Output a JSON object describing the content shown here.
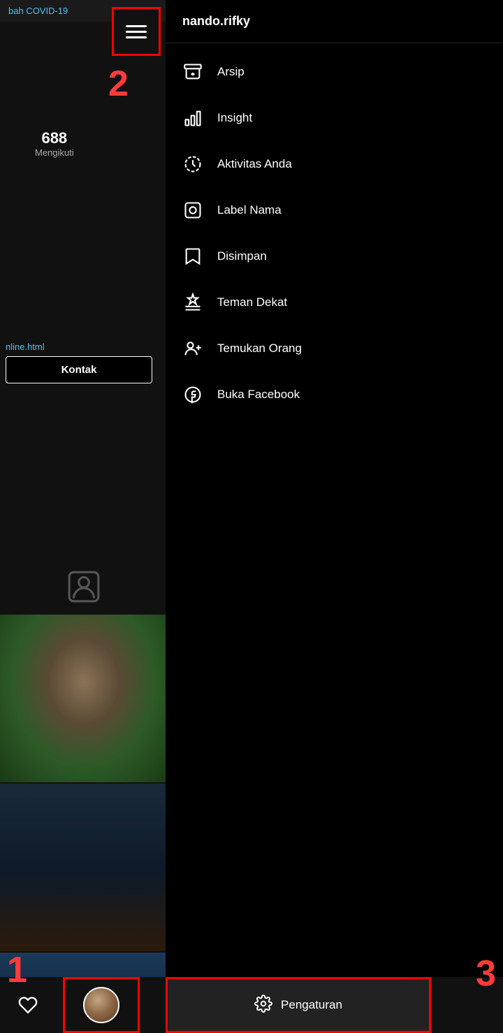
{
  "header": {
    "username": "nando.rifky"
  },
  "left": {
    "covid_text": "bah COVID-19",
    "following_count": "688",
    "following_label": "Mengikuti",
    "url_text": "nline.html",
    "kontak_label": "Kontak"
  },
  "menu": {
    "items": [
      {
        "id": "arsip",
        "label": "Arsip",
        "icon": "archive"
      },
      {
        "id": "insight",
        "label": "Insight",
        "icon": "bar-chart"
      },
      {
        "id": "aktivitas",
        "label": "Aktivitas Anda",
        "icon": "activity"
      },
      {
        "id": "label-nama",
        "label": "Label Nama",
        "icon": "label"
      },
      {
        "id": "disimpan",
        "label": "Disimpan",
        "icon": "bookmark"
      },
      {
        "id": "teman-dekat",
        "label": "Teman Dekat",
        "icon": "star-list"
      },
      {
        "id": "temukan-orang",
        "label": "Temukan Orang",
        "icon": "add-person"
      },
      {
        "id": "buka-facebook",
        "label": "Buka Facebook",
        "icon": "facebook"
      }
    ]
  },
  "bottom_bar": {
    "pengaturan_label": "Pengaturan"
  },
  "badges": {
    "b1": "1",
    "b2": "2",
    "b3": "3"
  }
}
